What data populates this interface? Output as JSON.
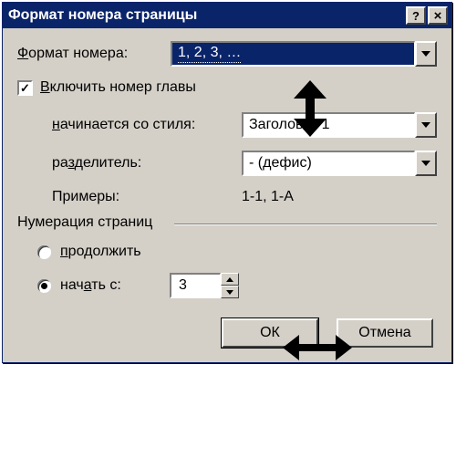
{
  "titlebar": {
    "title": "Формат номера страницы",
    "help": "?",
    "close": "×"
  },
  "format": {
    "label": "Формат номера:",
    "value": "1, 2, 3, …"
  },
  "includeChapter": {
    "label": " Включить номер главы",
    "checked": true
  },
  "chapter": {
    "startsWithStyleLabel_pre": "н",
    "startsWithStyleLabel_rest": "ачинается со стиля:",
    "startsWithStyleValue": "Заголовок 1",
    "separatorLabel_pre": "ра",
    "separatorLabel_mid": "з",
    "separatorLabel_rest": "делитель:",
    "separatorValue": "-    (дефис)",
    "examplesLabel": "Примеры:",
    "examplesValue": "1-1, 1-A"
  },
  "numbering": {
    "legend": "Нумерация страниц",
    "continueLabel": "продолжить",
    "startAtLabel_pre": "нач",
    "startAtLabel_mid": "а",
    "startAtLabel_rest": "ть с:",
    "startAtValue": "3"
  },
  "buttons": {
    "ok": "ОК",
    "cancel": "Отмена"
  }
}
